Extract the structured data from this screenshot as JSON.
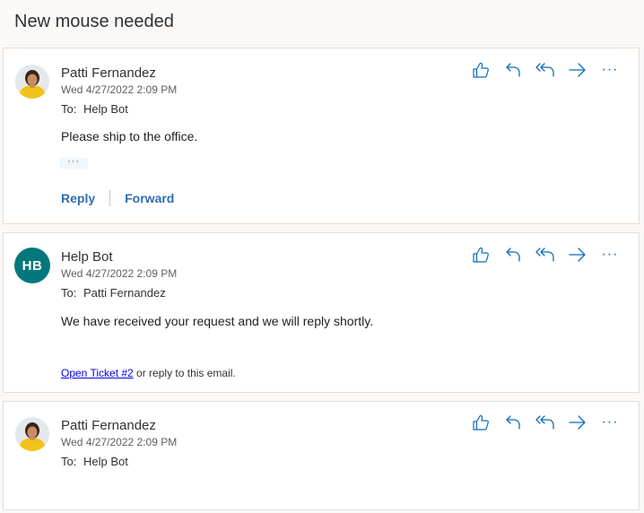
{
  "thread": {
    "title": "New mouse needed"
  },
  "messages": [
    {
      "sender": "Patti Fernandez",
      "date": "Wed 4/27/2022 2:09 PM",
      "to_label": "To:",
      "to": "Help Bot",
      "body": "Please ship to the office.",
      "expand_label": "···",
      "reply_label": "Reply",
      "forward_label": "Forward"
    },
    {
      "sender": "Help Bot",
      "initials": "HB",
      "date": "Wed 4/27/2022 2:09 PM",
      "to_label": "To:",
      "to": "Patti Fernandez",
      "body": "We have received your request and we will reply shortly.",
      "ticket_link": "Open Ticket #2",
      "footer_rest": " or reply to this email."
    },
    {
      "sender": "Patti Fernandez",
      "date": "Wed 4/27/2022 2:09 PM",
      "to_label": "To:",
      "to": "Help Bot"
    }
  ],
  "actions": {
    "more_label": "···"
  },
  "colors": {
    "accent": "#0f6cbd",
    "avatar_bg": "#03787c",
    "link": "#2e6cb5"
  }
}
